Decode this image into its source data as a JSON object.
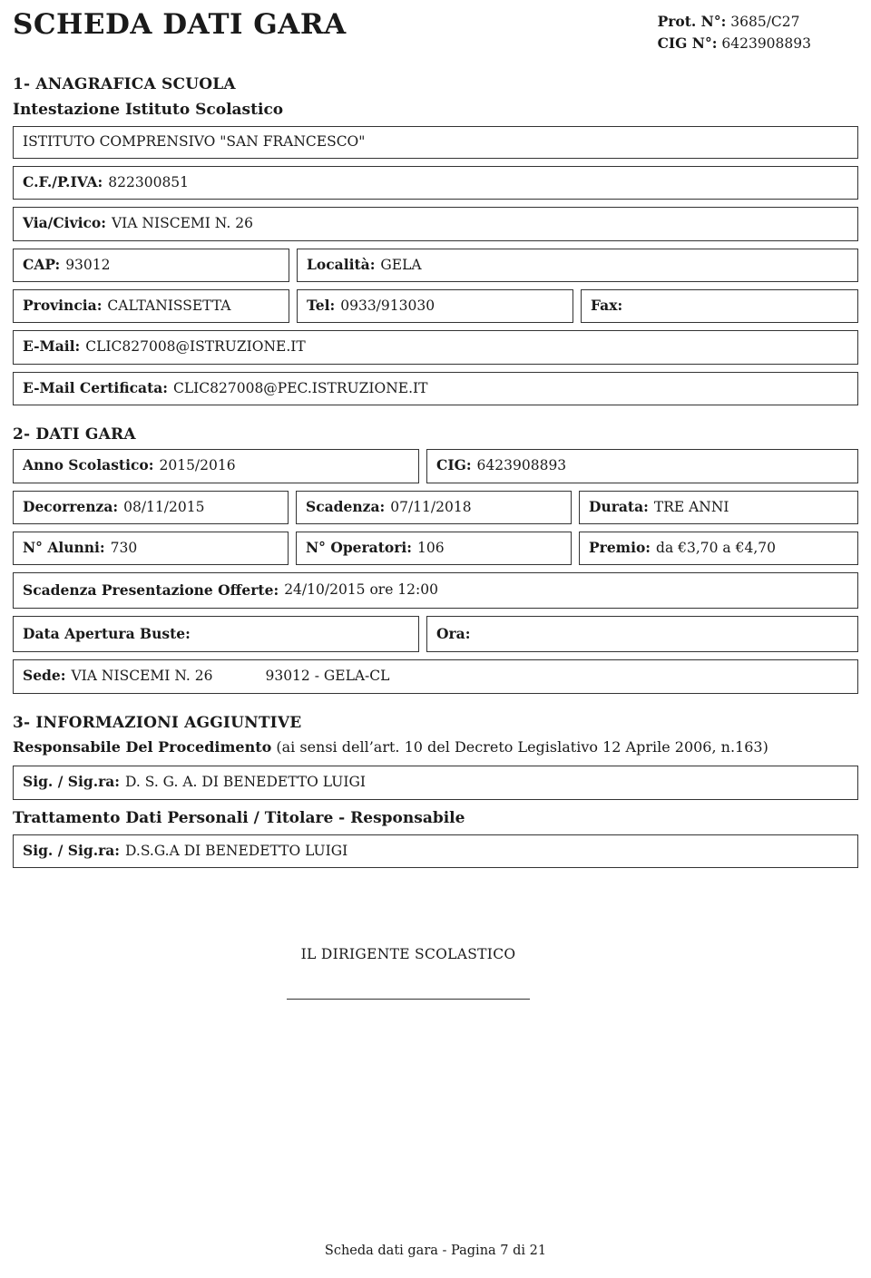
{
  "header": {
    "title": "SCHEDA DATI GARA",
    "prot_label": "Prot. N°:",
    "prot_value": "3685/C27",
    "cig_label": "CIG  N°:",
    "cig_value": "6423908893"
  },
  "section1": {
    "title": "1- ANAGRAFICA SCUOLA",
    "subtitle": "Intestazione Istituto Scolastico",
    "istituto": "ISTITUTO COMPRENSIVO \"SAN FRANCESCO\"",
    "cf_label": "C.F./P.IVA:",
    "cf_value": "822300851",
    "via_label": "Via/Civico:",
    "via_value": "VIA NISCEMI N. 26",
    "cap_label": "CAP:",
    "cap_value": "93012",
    "localita_label": "Località:",
    "localita_value": "GELA",
    "provincia_label": "Provincia:",
    "provincia_value": "CALTANISSETTA",
    "tel_label": "Tel:",
    "tel_value": "0933/913030",
    "fax_label": "Fax:",
    "fax_value": "",
    "email_label": "E-Mail:",
    "email_value": "CLIC827008@ISTRUZIONE.IT",
    "pec_label": "E-Mail Certificata:",
    "pec_value": "CLIC827008@PEC.ISTRUZIONE.IT"
  },
  "section2": {
    "title": "2- DATI GARA",
    "anno_label": "Anno Scolastico:",
    "anno_value": "2015/2016",
    "cig_label": "CIG:",
    "cig_value": "6423908893",
    "decorrenza_label": "Decorrenza:",
    "decorrenza_value": "08/11/2015",
    "scadenza_label": "Scadenza:",
    "scadenza_value": "07/11/2018",
    "durata_label": "Durata:",
    "durata_value": "TRE ANNI",
    "alunni_label": "N° Alunni:",
    "alunni_value": "730",
    "operatori_label": "N° Operatori:",
    "operatori_value": "106",
    "premio_label": "Premio:",
    "premio_value": "da €3,70 a €4,70",
    "offerte_label": "Scadenza Presentazione Offerte:",
    "offerte_value": "24/10/2015 ore 12:00",
    "apertura_label": "Data Apertura Buste:",
    "apertura_value": "",
    "ora_label": "Ora:",
    "ora_value": "",
    "sede_label": "Sede:",
    "sede_value": "VIA NISCEMI N. 26",
    "sede_value2": "93012   - GELA-CL"
  },
  "section3": {
    "title": "3- INFORMAZIONI AGGIUNTIVE",
    "resp_bold": "Responsabile Del Procedimento",
    "resp_rest": "(ai sensi dell’art. 10 del Decreto Legislativo 12 Aprile 2006, n.163)",
    "sig_label": "Sig. / Sig.ra:",
    "sig_value": "D. S. G. A.   DI BENEDETTO LUIGI",
    "tratt_title": "Trattamento Dati Personali / Titolare - Responsabile",
    "sig2_label": "Sig. / Sig.ra:",
    "sig2_value": "D.S.G.A DI BENEDETTO LUIGI"
  },
  "footer": {
    "signature_label": "IL DIRIGENTE SCOLASTICO",
    "page_label": "Scheda dati gara - Pagina 7 di 21"
  }
}
